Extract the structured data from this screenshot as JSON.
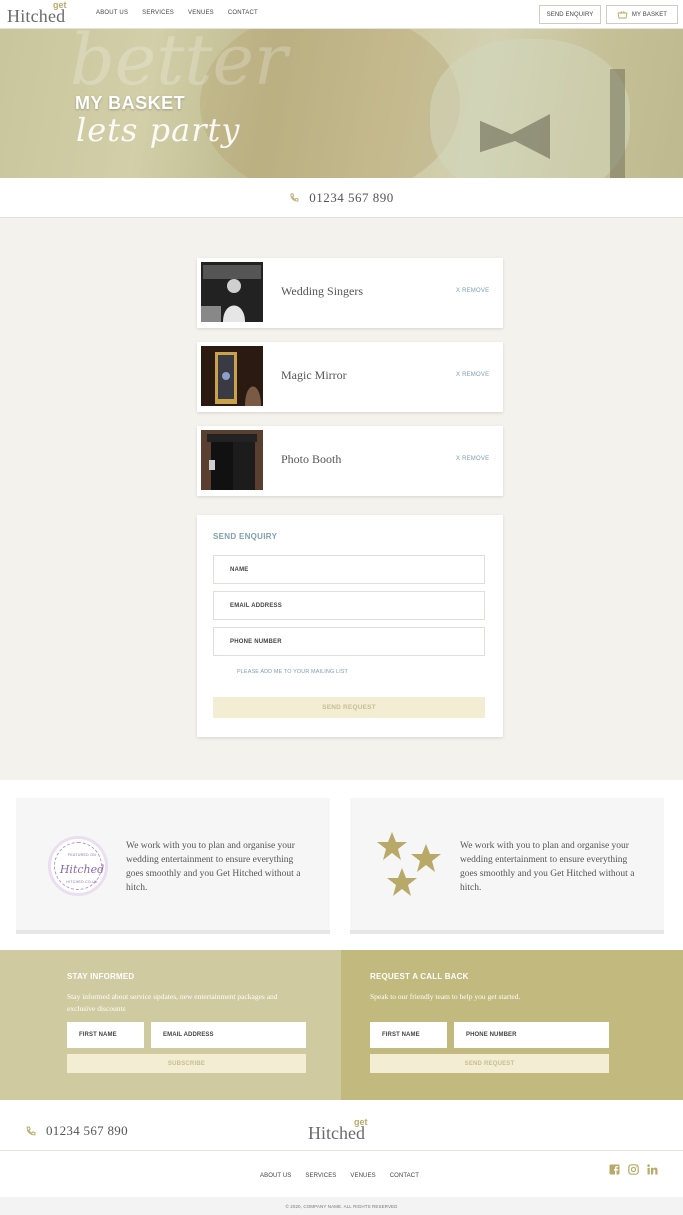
{
  "header": {
    "logo_word": "Hitched",
    "logo_get": "get",
    "nav": [
      "ABOUT US",
      "SERVICES",
      "VENUES",
      "CONTACT"
    ],
    "send_enquiry": "SEND ENQUIRY",
    "my_basket": "MY BASKET"
  },
  "hero": {
    "title": "MY BASKET",
    "script": "lets party",
    "watermark": "better"
  },
  "phone": "01234 567 890",
  "basket": [
    {
      "name": "Wedding Singers",
      "remove": "X REMOVE",
      "thumb": "wedding-singers-photo"
    },
    {
      "name": "Magic Mirror",
      "remove": "X REMOVE",
      "thumb": "magic-mirror-photo"
    },
    {
      "name": "Photo Booth",
      "remove": "X REMOVE",
      "thumb": "photo-booth-photo"
    }
  ],
  "enquiry": {
    "title": "SEND ENQUIRY",
    "name": "NAME",
    "email": "EMAIL ADDRESS",
    "phone": "PHONE NUMBER",
    "mailing": "PLEASE ADD ME TO YOUR MAILING LIST",
    "button": "SEND REQUEST"
  },
  "features": [
    {
      "icon": "featured-on-hitched-badge",
      "text": "We work with you to plan and organise your wedding entertainment to ensure everything goes smoothly and you Get Hitched without a hitch."
    },
    {
      "icon": "stars-icon",
      "text": "We work with you to plan and organise your wedding entertainment to ensure everything goes smoothly and you Get Hitched without a hitch."
    }
  ],
  "badge": {
    "top": "FEATURED ON",
    "word": "Hitched",
    "bottom": "HITCHED.CO.UK"
  },
  "stay_informed": {
    "title": "STAY INFORMED",
    "desc": "Stay informed about service updates, new entertainment packages and exclusive discounts",
    "first_name": "FIRST NAME",
    "email": "EMAIL ADDRESS",
    "button": "SUBSCRIBE"
  },
  "callback": {
    "title": "REQUEST A CALL BACK",
    "desc": "Speak to our friendly team to help you get started.",
    "first_name": "FIRST NAME",
    "phone": "PHONE NUMBER",
    "button": "SEND REQUEST"
  },
  "footer": {
    "phone": "01234 567 890",
    "nav": [
      "ABOUT US",
      "SERVICES",
      "VENUES",
      "CONTACT"
    ],
    "copyright": "© 2020, COMPANY NAME. ALL RIGHTS RESERVED"
  },
  "colors": {
    "accent_blue": "#7da0b0",
    "gold": "#b8a968",
    "strip_left": "#cfca9f",
    "strip_right": "#c1b97d",
    "button_bg": "#f3eed3"
  }
}
